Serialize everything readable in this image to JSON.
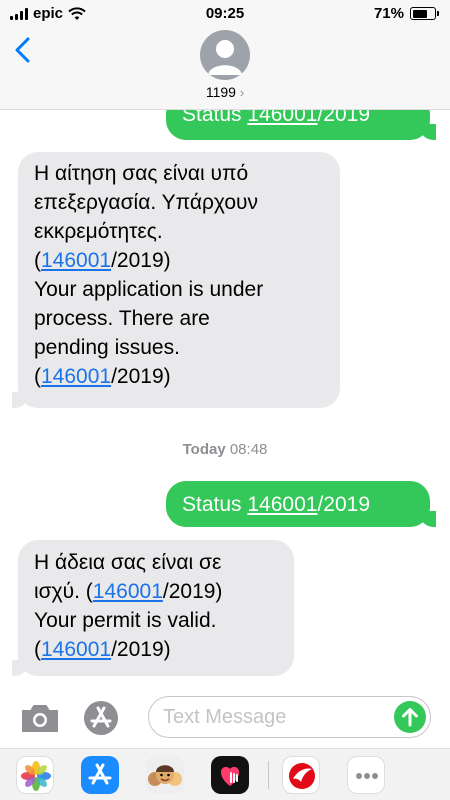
{
  "status_bar": {
    "carrier": "epic",
    "time": "09:25",
    "battery": "71%",
    "battery_level": 0.71
  },
  "header": {
    "contact": "1199",
    "chevron": "›"
  },
  "messages": [
    {
      "direction": "outgoing",
      "prefix": "Status ",
      "link": "146001",
      "suffix": "/2019"
    },
    {
      "direction": "incoming",
      "lines": [
        [
          {
            "t": "Η αίτηση σας είναι υπό"
          }
        ],
        [
          {
            "t": "επεξεργασία. Υπάρχουν"
          }
        ],
        [
          {
            "t": "εκκρεμότητες."
          }
        ],
        [
          {
            "t": "("
          },
          {
            "t": "146001",
            "link": true
          },
          {
            "t": "/2019)"
          }
        ],
        [
          {
            "t": "Your application is under"
          }
        ],
        [
          {
            "t": "process. There are"
          }
        ],
        [
          {
            "t": "pending issues."
          }
        ],
        [
          {
            "t": "("
          },
          {
            "t": "146001",
            "link": true
          },
          {
            "t": "/2019)"
          }
        ]
      ]
    },
    {
      "direction": "outgoing",
      "prefix": "Status ",
      "link": "146001",
      "suffix": "/2019"
    },
    {
      "direction": "incoming",
      "lines": [
        [
          {
            "t": "Η άδεια σας είναι σε"
          }
        ],
        [
          {
            "t": "ισχύ. ("
          },
          {
            "t": "146001",
            "link": true
          },
          {
            "t": "/2019)"
          }
        ],
        [
          {
            "t": "Your permit is valid."
          }
        ],
        [
          {
            "t": "("
          },
          {
            "t": "146001",
            "link": true
          },
          {
            "t": "/2019)"
          }
        ]
      ]
    }
  ],
  "timestamp": {
    "day": "Today",
    "time": "08:48"
  },
  "composer": {
    "placeholder": "Text Message"
  },
  "app_drawer": [
    {
      "name": "photos-app",
      "icon": "photos-icon"
    },
    {
      "name": "app-store-app",
      "icon": "app-store-icon"
    },
    {
      "name": "memoji-app",
      "icon": "memoji-icon"
    },
    {
      "name": "digital-touch-app",
      "icon": "heart-hand-icon"
    },
    {
      "name": "turkish-airlines-app",
      "icon": "turkish-airlines-icon"
    },
    {
      "name": "more-apps",
      "icon": "more-icon"
    }
  ],
  "colors": {
    "outgoing": "#34c759",
    "incoming": "#e9e9eb",
    "link": "#1a73e8",
    "header": "#f7f7f7"
  }
}
